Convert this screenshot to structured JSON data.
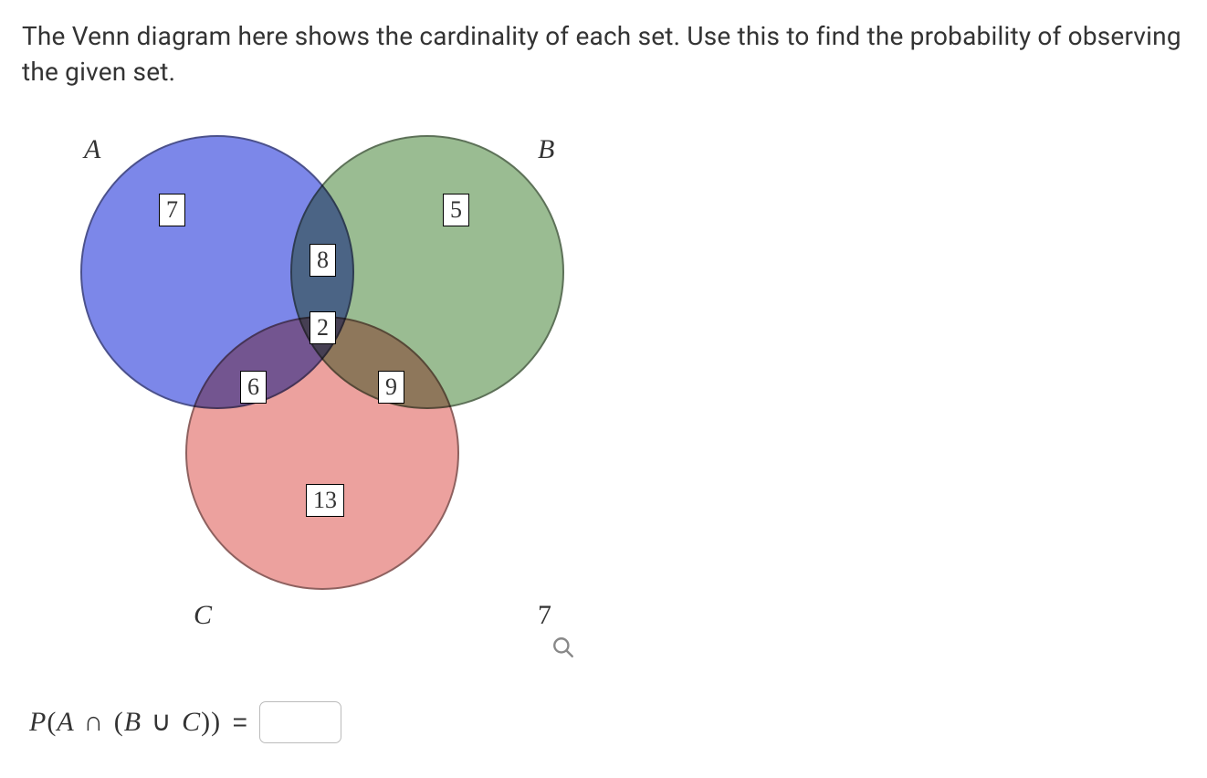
{
  "question": "The Venn diagram here shows the cardinality of each set. Use this to find the probability of observing the given set.",
  "venn": {
    "labels": {
      "A": "A",
      "B": "B",
      "C": "C"
    },
    "regions": {
      "a_only": "7",
      "b_only": "5",
      "c_only": "13",
      "ab": "8",
      "abc": "2",
      "ac": "6",
      "bc": "9",
      "outside": "7"
    }
  },
  "formula": {
    "P": "P",
    "A": "A",
    "B": "B",
    "C": "C",
    "intersect": "∩",
    "union": "∪",
    "equals": "="
  },
  "answer_value": ""
}
